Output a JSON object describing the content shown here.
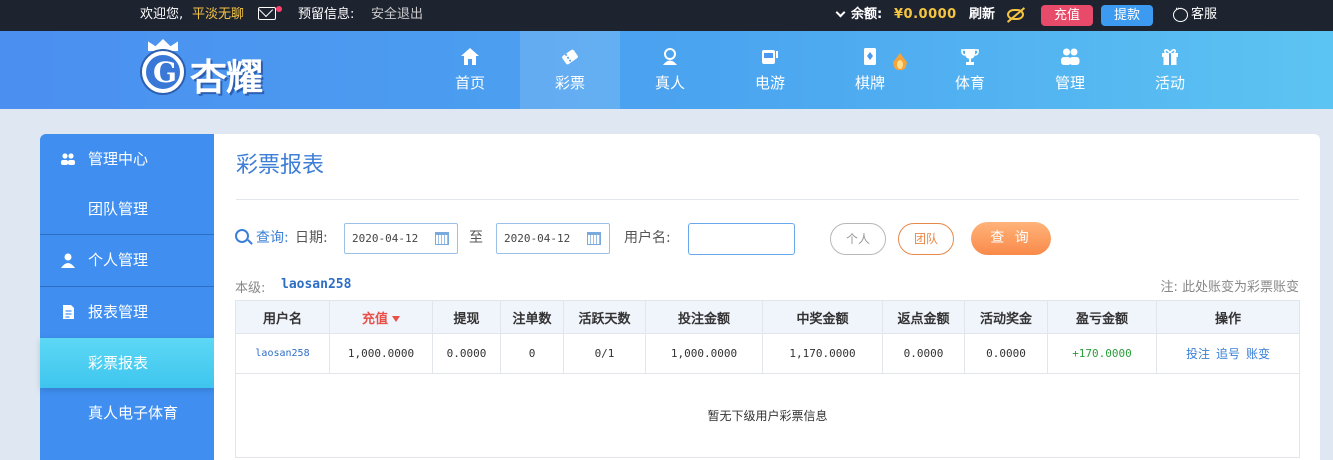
{
  "topbar": {
    "welcome": "欢迎您,",
    "username": "平淡无聊",
    "reserved_info": "预留信息:",
    "logout": "安全退出",
    "balance_label": "余额:",
    "balance_value": "¥0.0000",
    "refresh": "刷新",
    "recharge": "充值",
    "withdraw": "提款",
    "service": "客服"
  },
  "header": {
    "logo_text": "杏耀",
    "nav": [
      {
        "label": "首页",
        "icon": "home-icon"
      },
      {
        "label": "彩票",
        "icon": "lottery-icon",
        "active": true
      },
      {
        "label": "真人",
        "icon": "live-dealer-icon"
      },
      {
        "label": "电游",
        "icon": "slot-game-icon"
      },
      {
        "label": "棋牌",
        "icon": "card-game-icon",
        "hot": true
      },
      {
        "label": "体育",
        "icon": "trophy-icon"
      },
      {
        "label": "管理",
        "icon": "users-icon"
      },
      {
        "label": "活动",
        "icon": "gift-icon"
      }
    ]
  },
  "sidebar": {
    "items": [
      {
        "label": "管理中心",
        "icon": "team-icon"
      },
      {
        "label": "团队管理"
      },
      {
        "label": "个人管理",
        "icon": "user-icon"
      },
      {
        "label": "报表管理",
        "icon": "report-icon"
      },
      {
        "label": "彩票报表",
        "active": true
      },
      {
        "label": "真人电子体育"
      }
    ]
  },
  "main": {
    "title": "彩票报表",
    "query": {
      "label": "查询:",
      "date_label": "日期:",
      "date_from": "2020-04-12",
      "to": "至",
      "date_to": "2020-04-12",
      "username_label": "用户名:",
      "username_value": "",
      "personal": "个人",
      "team": "团队",
      "submit": "查 询"
    },
    "level_label": "本级:",
    "level_value": "laosan258",
    "note": "注: 此处账变为彩票账变",
    "table": {
      "headers": [
        "用户名",
        "充值",
        "提现",
        "注单数",
        "活跃天数",
        "投注金额",
        "中奖金额",
        "返点金额",
        "活动奖金",
        "盈亏金额",
        "操作"
      ],
      "row": {
        "username": "laosan258",
        "recharge": "1,000.0000",
        "withdraw": "0.0000",
        "orders": "0",
        "active_days": "0/1",
        "bet_amount": "1,000.0000",
        "win_amount": "1,170.0000",
        "rebate": "0.0000",
        "bonus": "0.0000",
        "profit": "+170.0000",
        "ops": [
          "投注",
          "追号",
          "账变"
        ]
      },
      "empty_text": "暂无下级用户彩票信息"
    }
  }
}
